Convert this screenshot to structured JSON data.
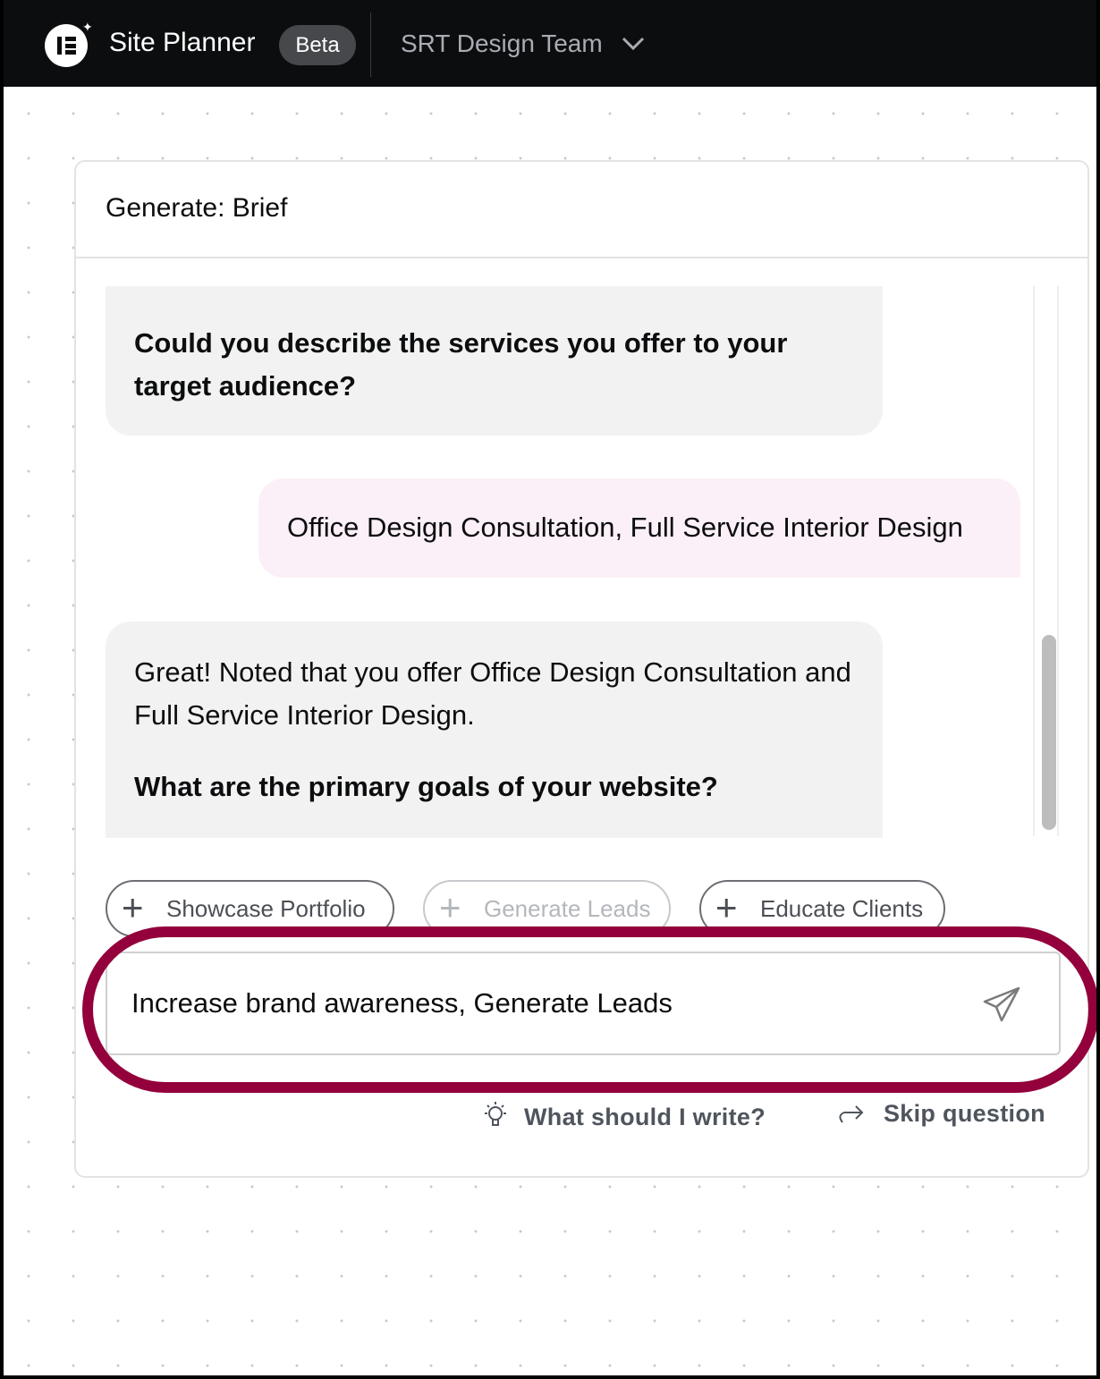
{
  "header": {
    "app_title": "Site Planner",
    "badge": "Beta",
    "workspace": "SRT Design Team",
    "logo_text": "IE"
  },
  "panel": {
    "title": "Generate: Brief"
  },
  "chat": {
    "messages": [
      {
        "role": "assistant",
        "text": "",
        "question": "Could you describe the services you offer to your target audience?"
      },
      {
        "role": "user",
        "text": "Office Design Consultation, Full Service Interior Design"
      },
      {
        "role": "assistant",
        "text": "Great! Noted that you offer Office Design Consultation and Full Service Interior Design.",
        "question": "What are the primary goals of your website?"
      }
    ]
  },
  "suggestions": [
    {
      "label": "Showcase Portfolio",
      "disabled": false
    },
    {
      "label": "Generate Leads",
      "disabled": true
    },
    {
      "label": "Educate Clients",
      "disabled": false
    }
  ],
  "input": {
    "value": "Increase brand awareness, Generate Leads"
  },
  "actions": {
    "help": "What should I write?",
    "skip": "Skip question"
  },
  "colors": {
    "highlight": "#93003c",
    "user_bubble": "#fcf0f8",
    "assistant_bubble": "#f2f2f2",
    "topbar": "#0c0d0f"
  }
}
